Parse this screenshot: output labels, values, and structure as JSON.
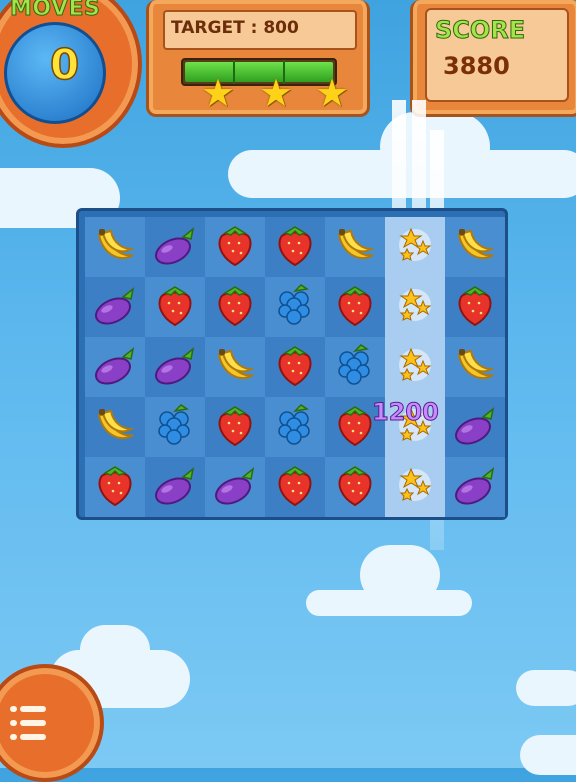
{
  "hud": {
    "moves_label": "MOVES",
    "moves_value": "0",
    "target_label": "TARGET : 800",
    "target_progress": 1.0,
    "stars_earned": 3,
    "score_label": "SCORE",
    "score_value": "3880"
  },
  "board": {
    "rows": 5,
    "cols": 7,
    "highlighted_column": 5,
    "cells": [
      [
        "banana",
        "eggplant",
        "strawberry",
        "strawberry",
        "banana",
        "star-burst",
        "banana"
      ],
      [
        "eggplant",
        "strawberry",
        "strawberry",
        "grapes",
        "strawberry",
        "star-burst",
        "strawberry"
      ],
      [
        "eggplant",
        "eggplant",
        "banana",
        "strawberry",
        "grapes",
        "star-burst",
        "banana"
      ],
      [
        "banana",
        "grapes",
        "strawberry",
        "grapes",
        "strawberry",
        "star-burst",
        "eggplant"
      ],
      [
        "strawberry",
        "eggplant",
        "eggplant",
        "strawberry",
        "strawberry",
        "star-burst",
        "eggplant"
      ]
    ],
    "combo_text": "1200"
  },
  "menu": {
    "icon": "menu-list-icon"
  },
  "colors": {
    "panel_orange": "#e8873c",
    "moves_green": "#a6e34a",
    "board_blue": "#2d6fb3"
  }
}
